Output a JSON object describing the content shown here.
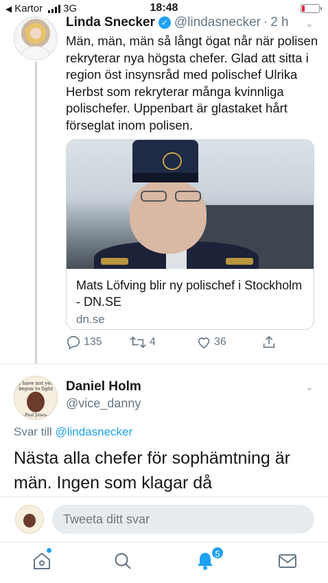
{
  "status_bar": {
    "back_label": "Kartor",
    "network": "3G",
    "time": "18:48"
  },
  "tweet": {
    "author_name": "Linda Snecker",
    "author_handle": "@lindasnecker",
    "separator": "·",
    "age": "2 h",
    "text": "Män, män, män så långt ögat når när polisen rekryterar nya högsta chefer. Glad att sitta i region öst insynsråd med polischef Ulrika Herbst som rekryterar många kvinnliga polischefer. Uppenbart är glastaket hårt förseglat inom polisen.",
    "card": {
      "title": "Mats Löfving blir ny polischef i Stockholm - DN.SE",
      "domain": "dn.se"
    },
    "actions": {
      "replies": "135",
      "retweets": "4",
      "likes": "36"
    }
  },
  "reply": {
    "author_name": "Daniel Holm",
    "author_handle": "@vice_danny",
    "reply_to_prefix": "Svar till",
    "reply_to_handle": "@lindasnecker",
    "text": "Nästa alla chefer för sophämtning är män. Ingen som klagar då",
    "avatar_text_top": "I have not yet begun to fight",
    "avatar_text_bottom": "-Paul Jones-"
  },
  "compose": {
    "placeholder": "Tweeta ditt svar"
  },
  "tabbar": {
    "notification_count": "5",
    "icons": [
      "home-icon",
      "search-icon",
      "bell-icon",
      "mail-icon"
    ],
    "accent_color": "#1da1f2"
  }
}
